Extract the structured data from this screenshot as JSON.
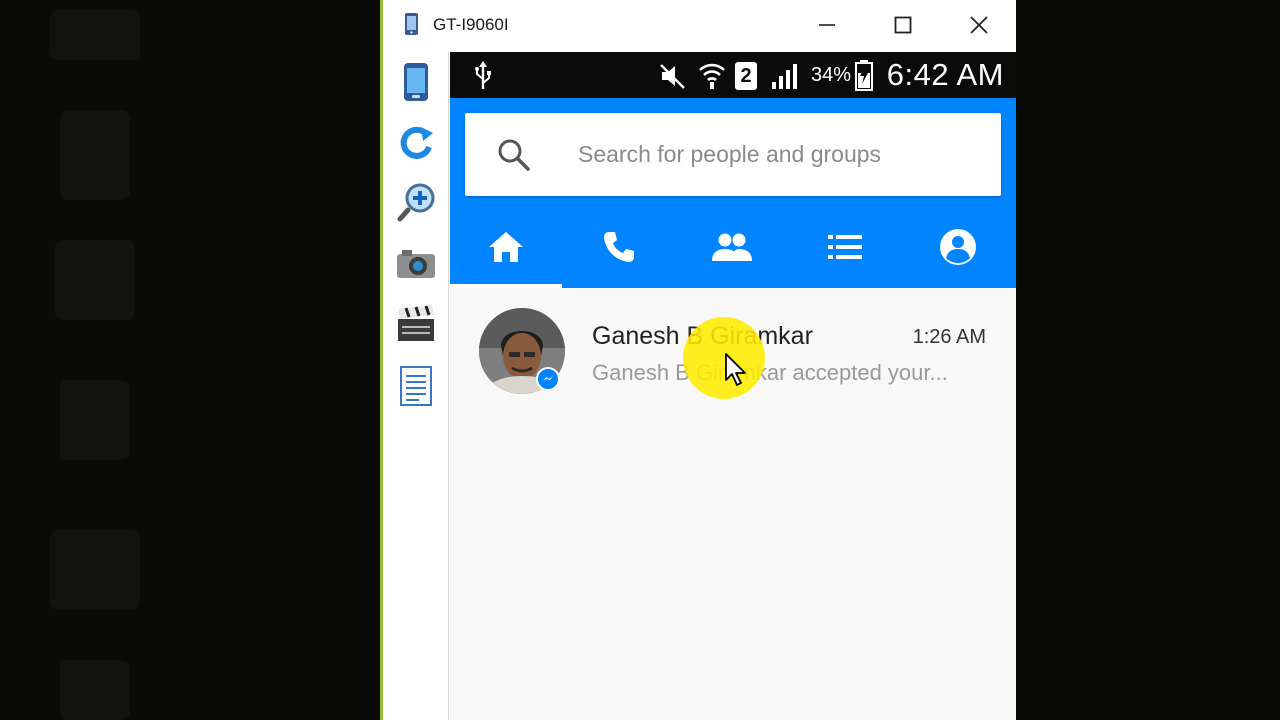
{
  "window": {
    "title": "GT-I9060I",
    "controls": {
      "minimize_icon": "minimize-icon",
      "maximize_icon": "maximize-icon",
      "close_icon": "close-icon"
    }
  },
  "toolbar": {
    "tools": [
      "phone-icon",
      "rotate-icon",
      "zoom-in-icon",
      "camera-icon",
      "clapperboard-icon",
      "document-icon"
    ]
  },
  "status_bar": {
    "icons": [
      "usb-icon",
      "mute-icon",
      "wifi-icon",
      "sim-2-icon",
      "signal-icon",
      "battery-icon"
    ],
    "sim_slot": "2",
    "battery_percent": "34%",
    "time": "6:42 AM"
  },
  "search": {
    "placeholder": "Search for people and groups"
  },
  "tabs": [
    {
      "name": "home",
      "icon": "home-icon",
      "active": true
    },
    {
      "name": "calls",
      "icon": "phone-icon"
    },
    {
      "name": "groups",
      "icon": "people-icon"
    },
    {
      "name": "active",
      "icon": "list-icon"
    },
    {
      "name": "profile",
      "icon": "account-icon"
    }
  ],
  "conversations": [
    {
      "name": "Ganesh B Giramkar",
      "time": "1:26 AM",
      "preview": "Ganesh B Giramkar accepted your..."
    }
  ],
  "colors": {
    "accent": "#0084ff",
    "status_bar": "#0b0b0b",
    "window_border": "#9bbd3a",
    "cursor_highlight": "#ffec00"
  }
}
